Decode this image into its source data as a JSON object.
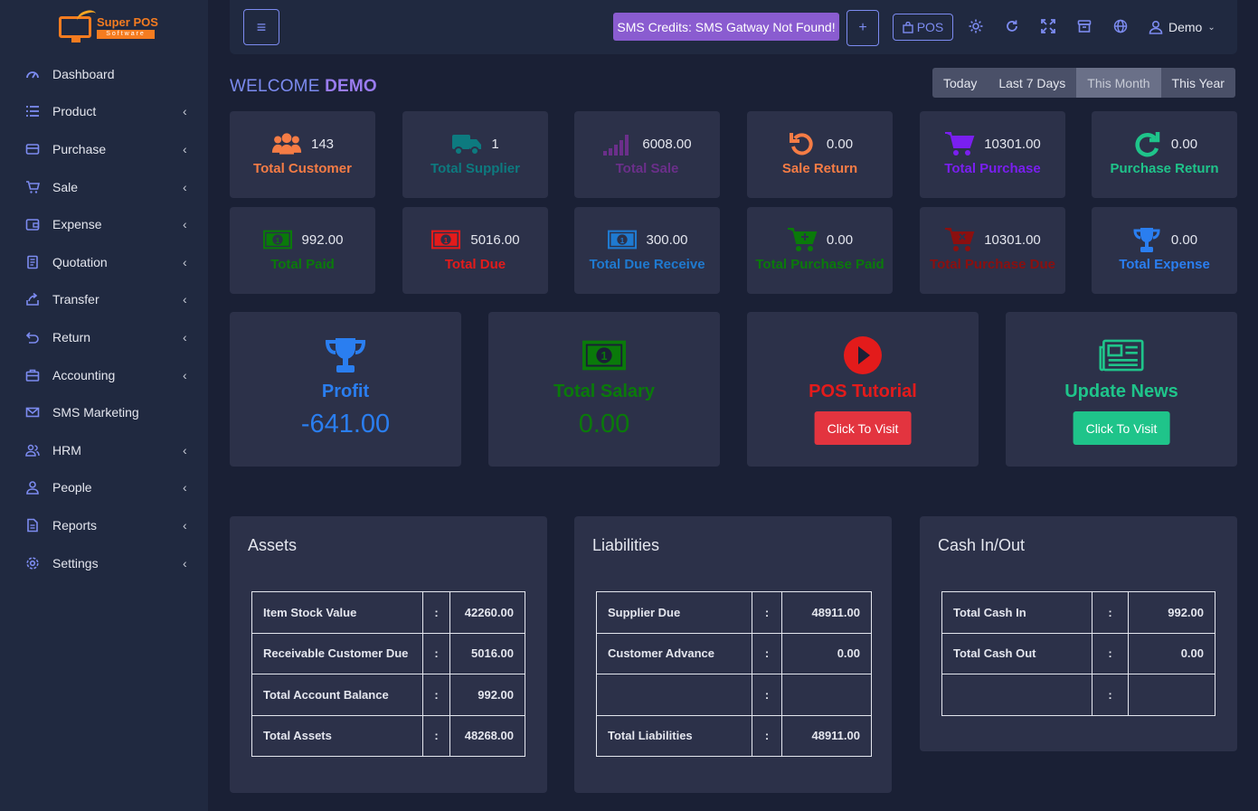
{
  "app": {
    "logo_title": "Super POS",
    "logo_subtitle": "Software"
  },
  "sidebar": {
    "items": [
      {
        "label": "Dashboard",
        "icon": "gauge-icon",
        "has_sub": false
      },
      {
        "label": "Product",
        "icon": "list-icon",
        "has_sub": true
      },
      {
        "label": "Purchase",
        "icon": "credit-card-icon",
        "has_sub": true
      },
      {
        "label": "Sale",
        "icon": "cart-icon",
        "has_sub": true
      },
      {
        "label": "Expense",
        "icon": "wallet-icon",
        "has_sub": true
      },
      {
        "label": "Quotation",
        "icon": "document-icon",
        "has_sub": true
      },
      {
        "label": "Transfer",
        "icon": "share-icon",
        "has_sub": true
      },
      {
        "label": "Return",
        "icon": "return-icon",
        "has_sub": true
      },
      {
        "label": "Accounting",
        "icon": "briefcase-icon",
        "has_sub": true
      },
      {
        "label": "SMS Marketing",
        "icon": "envelope-icon",
        "has_sub": false
      },
      {
        "label": "HRM",
        "icon": "users-icon",
        "has_sub": true
      },
      {
        "label": "People",
        "icon": "user-icon",
        "has_sub": true
      },
      {
        "label": "Reports",
        "icon": "file-icon",
        "has_sub": true
      },
      {
        "label": "Settings",
        "icon": "gear-icon",
        "has_sub": true
      }
    ],
    "chevron": "‹"
  },
  "topbar": {
    "sms_text": "SMS Credits: SMS Gatway Not Found!",
    "plus": "+",
    "pos_label": "POS",
    "user_name": "Demo"
  },
  "welcome": {
    "prefix": "WELCOME",
    "name": "DEMO"
  },
  "periods": [
    "Today",
    "Last 7 Days",
    "This Month",
    "This Year"
  ],
  "cards_row1": [
    {
      "value": "143",
      "title": "Total Customer",
      "color": "#f57c45"
    },
    {
      "value": "1",
      "title": "Total Supplier",
      "color": "#0d7a7f"
    },
    {
      "value": "6008.00",
      "title": "Total Sale",
      "color": "#6b2f8a"
    },
    {
      "value": "0.00",
      "title": "Sale Return",
      "color": "#f57c45"
    },
    {
      "value": "10301.00",
      "title": "Total Purchase",
      "color": "#7a1ff0"
    },
    {
      "value": "0.00",
      "title": "Purchase Return",
      "color": "#1fc48a"
    }
  ],
  "cards_row2": [
    {
      "value": "992.00",
      "title": "Total Paid",
      "color": "#0a7a0a"
    },
    {
      "value": "5016.00",
      "title": "Total Due",
      "color": "#e31b1b"
    },
    {
      "value": "300.00",
      "title": "Total Due Receive",
      "color": "#1f7ad0"
    },
    {
      "value": "0.00",
      "title": "Total Purchase Paid",
      "color": "#0a7a0a"
    },
    {
      "value": "10301.00",
      "title": "Total Purchase Due",
      "color": "#8b0f0f"
    },
    {
      "value": "0.00",
      "title": "Total Expense",
      "color": "#2a7ef0"
    }
  ],
  "big_cards": {
    "profit": {
      "title": "Profit",
      "value": "-641.00"
    },
    "salary": {
      "title": "Total Salary",
      "value": "0.00"
    },
    "tutorial": {
      "title": "POS Tutorial",
      "button": "Click To Visit"
    },
    "news": {
      "title": "Update News",
      "button": "Click To Visit"
    }
  },
  "assets": {
    "title": "Assets",
    "rows": [
      {
        "label": "Item Stock Value",
        "sep": ":",
        "value": "42260.00"
      },
      {
        "label": "Receivable Customer Due",
        "sep": ":",
        "value": "5016.00"
      },
      {
        "label": "Total Account Balance",
        "sep": ":",
        "value": "992.00"
      },
      {
        "label": "Total Assets",
        "sep": ":",
        "value": "48268.00"
      }
    ]
  },
  "liabilities": {
    "title": "Liabilities",
    "rows": [
      {
        "label": "Supplier Due",
        "sep": ":",
        "value": "48911.00"
      },
      {
        "label": "Customer Advance",
        "sep": ":",
        "value": "0.00"
      },
      {
        "label": "",
        "sep": ":",
        "value": ""
      },
      {
        "label": "Total Liabilities",
        "sep": ":",
        "value": "48911.00"
      }
    ]
  },
  "cash": {
    "title": "Cash In/Out",
    "rows": [
      {
        "label": "Total Cash In",
        "sep": ":",
        "value": "992.00"
      },
      {
        "label": "Total Cash Out",
        "sep": ":",
        "value": "0.00"
      },
      {
        "label": "",
        "sep": ":",
        "value": ""
      }
    ]
  }
}
